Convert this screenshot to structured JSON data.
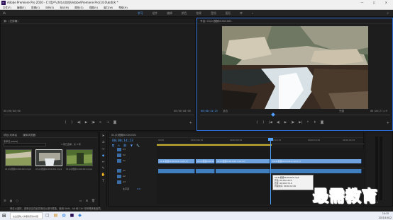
{
  "titlebar": {
    "app_icon": "Pr",
    "title": "Adobe Premiere Pro 2020 - C:\\用户\\chitu\\文档\\Adobe\\Premiere Pro\\14.0\\未命名 *",
    "controls": "— ☐ ✕"
  },
  "menubar": {
    "items": [
      "文件(F)",
      "编辑(E)",
      "剪辑(C)",
      "序列(S)",
      "标记(M)",
      "图形(G)",
      "视图(V)",
      "窗口(W)",
      "帮助(H)"
    ]
  },
  "workspaces": {
    "tabs": [
      "学习",
      "组件",
      "编辑",
      "颜色",
      "效果",
      "音频",
      "图形",
      "库"
    ],
    "active_index": 0,
    "more": "»"
  },
  "source_panel": {
    "title": "源：(无剪辑)",
    "timecode_left": "00;00;00;00",
    "timecode_right": "00;00;00;00"
  },
  "program_panel": {
    "title": "节目: 01(2)视频01001001",
    "timecode": "00;00;14;23",
    "fit": "适合",
    "quality": "完整",
    "duration": "00;00;27;19"
  },
  "project_panel": {
    "tabs": [
      "项目:未命名",
      "媒体浏览器"
    ],
    "path": "未命名.prproj",
    "search_placeholder": "",
    "item_count": "3 项已选择，共 3 项",
    "items": [
      {
        "name": "01(2)视频01001001.mp4",
        "duration": "7;22"
      },
      {
        "name": "01(2)视频01001001.mp4",
        "duration": "8;05"
      },
      {
        "name": "01(2)视频01001001.mp4",
        "duration": "9;15"
      }
    ]
  },
  "timeline": {
    "sequence_tab": "01(2)视频01001001",
    "timecode": "00;00;14;23",
    "ruler": [
      "00;00",
      "00;00;04;29",
      "00;00;09;29",
      "00;00;14;29",
      "00;00;19;29",
      "00;00;24;29"
    ],
    "tracks": [
      "V3",
      "V2",
      "V1",
      "A1",
      "A2",
      "A3"
    ],
    "master": "主声道",
    "master_value": "0.0",
    "clips": [
      "01(2)视频01001001.mp4 [V]",
      "01(2)视频01001001",
      "01(2)视频01001001.mp4 [V]",
      "01(2)视频01001001.mp4 [V]"
    ],
    "tooltip": {
      "name": "01(2)视频01001001.mp4",
      "start": "开始: 00;00;14;23",
      "end": "结束: 00;00;27;19",
      "duration": "持续时间: 00;00;12;26"
    }
  },
  "statusbar": {
    "text": "单击以选择，或单击空白处并拖动以进行框选。使用 Shift、Alt 和 Ctrl 可获得其他选项。"
  },
  "taskbar": {
    "search_placeholder": "在这里输入你要搜索的内容",
    "time": "14:15",
    "date": "2021/10/12"
  },
  "watermark": {
    "text": "最需教育"
  }
}
